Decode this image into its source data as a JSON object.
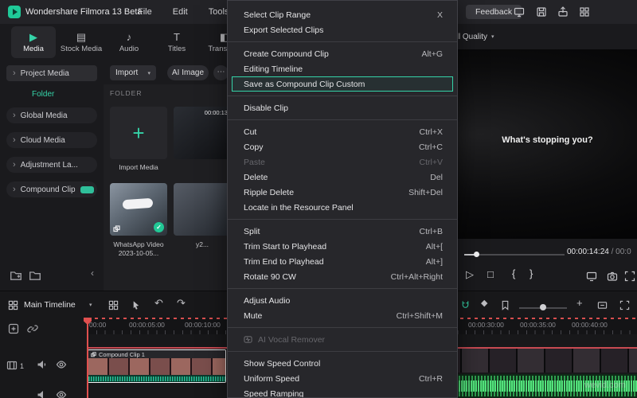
{
  "accent": "#35d3a8",
  "titlebar": {
    "app_title": "Wondershare Filmora 13 Beta",
    "menus": [
      "File",
      "Edit",
      "Tools"
    ],
    "feedback": "Feedback"
  },
  "nav_tabs": [
    {
      "label": "Media",
      "icon": "media-icon",
      "active": true
    },
    {
      "label": "Stock Media",
      "icon": "stock-media-icon"
    },
    {
      "label": "Audio",
      "icon": "audio-icon"
    },
    {
      "label": "Titles",
      "icon": "titles-icon"
    },
    {
      "label": "Transition",
      "icon": "transition-icon"
    }
  ],
  "sidebar": {
    "items": [
      {
        "label": "Project Media",
        "kind": "header"
      },
      {
        "label": "Folder",
        "kind": "active-folder"
      },
      {
        "label": "Global Media",
        "kind": "item"
      },
      {
        "label": "Cloud Media",
        "kind": "item"
      },
      {
        "label": "Adjustment La...",
        "kind": "item"
      },
      {
        "label": "Compound Clip",
        "kind": "item",
        "badge": true
      }
    ]
  },
  "media_panel": {
    "import_button": "Import",
    "ai_image_button": "AI Image",
    "section_label": "FOLDER",
    "tiles": [
      {
        "label": "Import Media",
        "kind": "import"
      },
      {
        "label": "",
        "duration": "00:00:13",
        "kind": "clip"
      },
      {
        "label": "WhatsApp Video 2023-10-05...",
        "kind": "clip",
        "selected": true
      },
      {
        "label": "y2...",
        "kind": "clip"
      }
    ]
  },
  "context_menu": {
    "items": [
      {
        "label": "Select Clip Range",
        "shortcut": "X"
      },
      {
        "label": "Export Selected Clips"
      },
      {
        "sep": true
      },
      {
        "label": "Create Compound Clip",
        "shortcut": "Alt+G"
      },
      {
        "label": "Editing Timeline"
      },
      {
        "label": "Save as Compound Clip Custom",
        "highlight": true
      },
      {
        "sep": true
      },
      {
        "label": "Disable Clip"
      },
      {
        "sep": true
      },
      {
        "label": "Cut",
        "shortcut": "Ctrl+X"
      },
      {
        "label": "Copy",
        "shortcut": "Ctrl+C"
      },
      {
        "label": "Paste",
        "shortcut": "Ctrl+V",
        "disabled": true
      },
      {
        "label": "Delete",
        "shortcut": "Del"
      },
      {
        "label": "Ripple Delete",
        "shortcut": "Shift+Del"
      },
      {
        "label": "Locate in the Resource Panel"
      },
      {
        "sep": true
      },
      {
        "label": "Split",
        "shortcut": "Ctrl+B"
      },
      {
        "label": "Trim Start to Playhead",
        "shortcut": "Alt+["
      },
      {
        "label": "Trim End to Playhead",
        "shortcut": "Alt+]"
      },
      {
        "label": "Rotate 90 CW",
        "shortcut": "Ctrl+Alt+Right"
      },
      {
        "sep": true
      },
      {
        "label": "Adjust Audio"
      },
      {
        "label": "Mute",
        "shortcut": "Ctrl+Shift+M"
      },
      {
        "sep": true
      },
      {
        "label": "AI Vocal Remover",
        "disabled": true,
        "icon": "ai-vocal-remover-icon"
      },
      {
        "sep": true
      },
      {
        "label": "Show Speed Control"
      },
      {
        "label": "Uniform Speed",
        "shortcut": "Ctrl+R"
      },
      {
        "label": "Speed Ramping"
      }
    ]
  },
  "preview": {
    "quality": "Full Quality",
    "overlay_text": "What's stopping you?",
    "current_time": "00:00:14:24",
    "time_separator": "/",
    "total_time": "00:0"
  },
  "timeline": {
    "label": "Main Timeline",
    "ruler": [
      "00:00",
      "00:00:05:00",
      "00:00:10:00",
      "00:00:30:00",
      "00:00:35:00",
      "00:00:40:00"
    ],
    "clip_name": "Compound Clip 1",
    "track_number": "1"
  },
  "watermark": "wevid.com"
}
